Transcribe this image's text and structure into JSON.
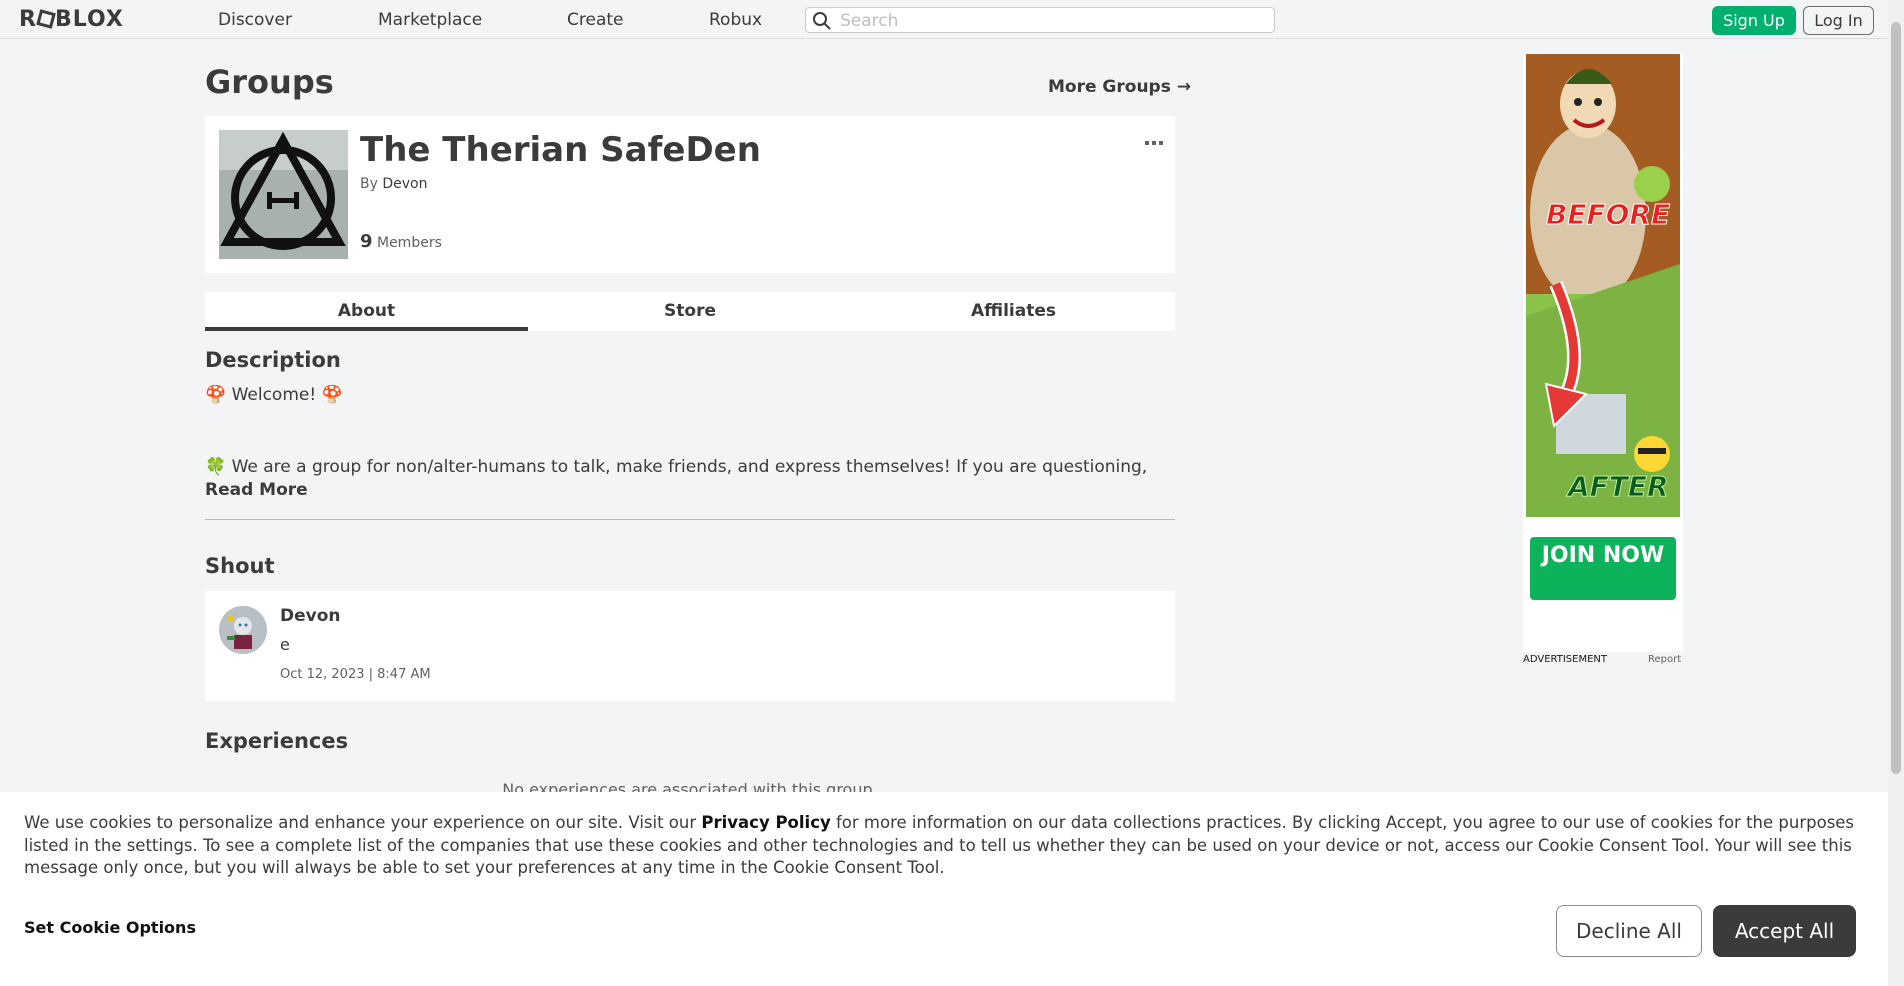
{
  "nav": {
    "logo": "ROBLOX",
    "links": [
      "Discover",
      "Marketplace",
      "Create",
      "Robux"
    ],
    "search_placeholder": "Search",
    "sign_up": "Sign Up",
    "log_in": "Log In"
  },
  "page": {
    "title": "Groups",
    "more_groups": "More Groups →"
  },
  "group": {
    "name": "The Therian SafeDen",
    "by_label": "By",
    "owner": "Devon",
    "member_count": "9",
    "members_label": "Members",
    "more_icon": "ellipsis-icon"
  },
  "tabs": [
    {
      "label": "About",
      "active": true
    },
    {
      "label": "Store",
      "active": false
    },
    {
      "label": "Affiliates",
      "active": false
    }
  ],
  "description": {
    "heading": "Description",
    "line1": "🍄 Welcome! 🍄",
    "line2": "🍀 We are a group for non/alter-humans to talk, make friends, and express themselves! If you are questioning,",
    "read_more": "Read More"
  },
  "shout": {
    "heading": "Shout",
    "user": "Devon",
    "body": "e",
    "date": "Oct 12, 2023 | 8:47 AM"
  },
  "experiences": {
    "heading": "Experiences",
    "empty": "No experiences are associated with this group."
  },
  "ad": {
    "before": "BEFORE",
    "after": "AFTER",
    "join": "JOIN NOW",
    "label": "ADVERTISEMENT",
    "report": "Report"
  },
  "cookie": {
    "text_pre": "We use cookies to personalize and enhance your experience on our site. Visit our ",
    "privacy": "Privacy Policy",
    "text_post": " for more information on our data collections practices. By clicking Accept, you agree to our use of cookies for the purposes listed in the settings. To see a complete list of the companies that use these cookies and other technologies and to tell us whether they can be used on your device or not, access our Cookie Consent Tool. Your will see this message only once, but you will always be able to set your preferences at any time in the Cookie Consent Tool.",
    "options": "Set Cookie Options",
    "decline": "Decline All",
    "accept": "Accept All"
  }
}
